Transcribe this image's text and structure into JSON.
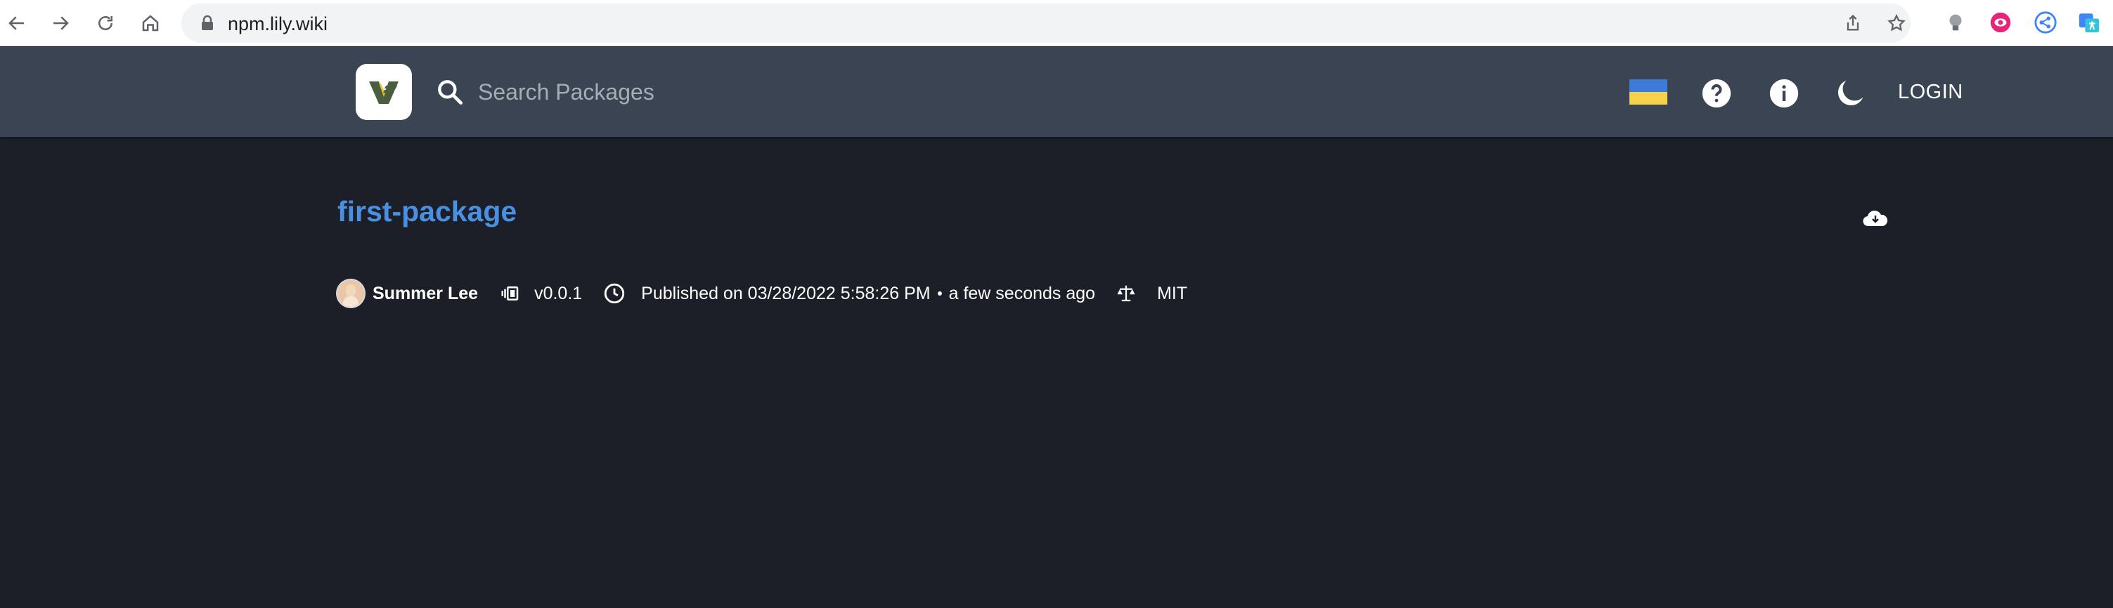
{
  "browser": {
    "url": "npm.lily.wiki",
    "icons": [
      "back-arrow-icon",
      "forward-arrow-icon",
      "reload-icon",
      "home-icon",
      "lock-icon",
      "share-icon",
      "star-icon",
      "lightbulb-extension-icon",
      "eye-extension-icon",
      "share-extension-icon",
      "translate-extension-icon"
    ]
  },
  "header": {
    "search_placeholder": "Search Packages",
    "login_label": "LOGIN",
    "icons": [
      "verdaccio-logo",
      "search-icon",
      "ukraine-flag-icon",
      "help-icon",
      "info-icon",
      "dark-mode-icon"
    ]
  },
  "package": {
    "name": "first-package",
    "author": "Summer Lee",
    "version": "v0.0.1",
    "published": "Published on 03/28/2022 5:58:26 PM",
    "relative_time": "a few seconds ago",
    "license": "MIT"
  },
  "colors": {
    "page_bg": "#1c1f28",
    "header_bg": "#3a4452",
    "title_link": "#4a90e2"
  }
}
